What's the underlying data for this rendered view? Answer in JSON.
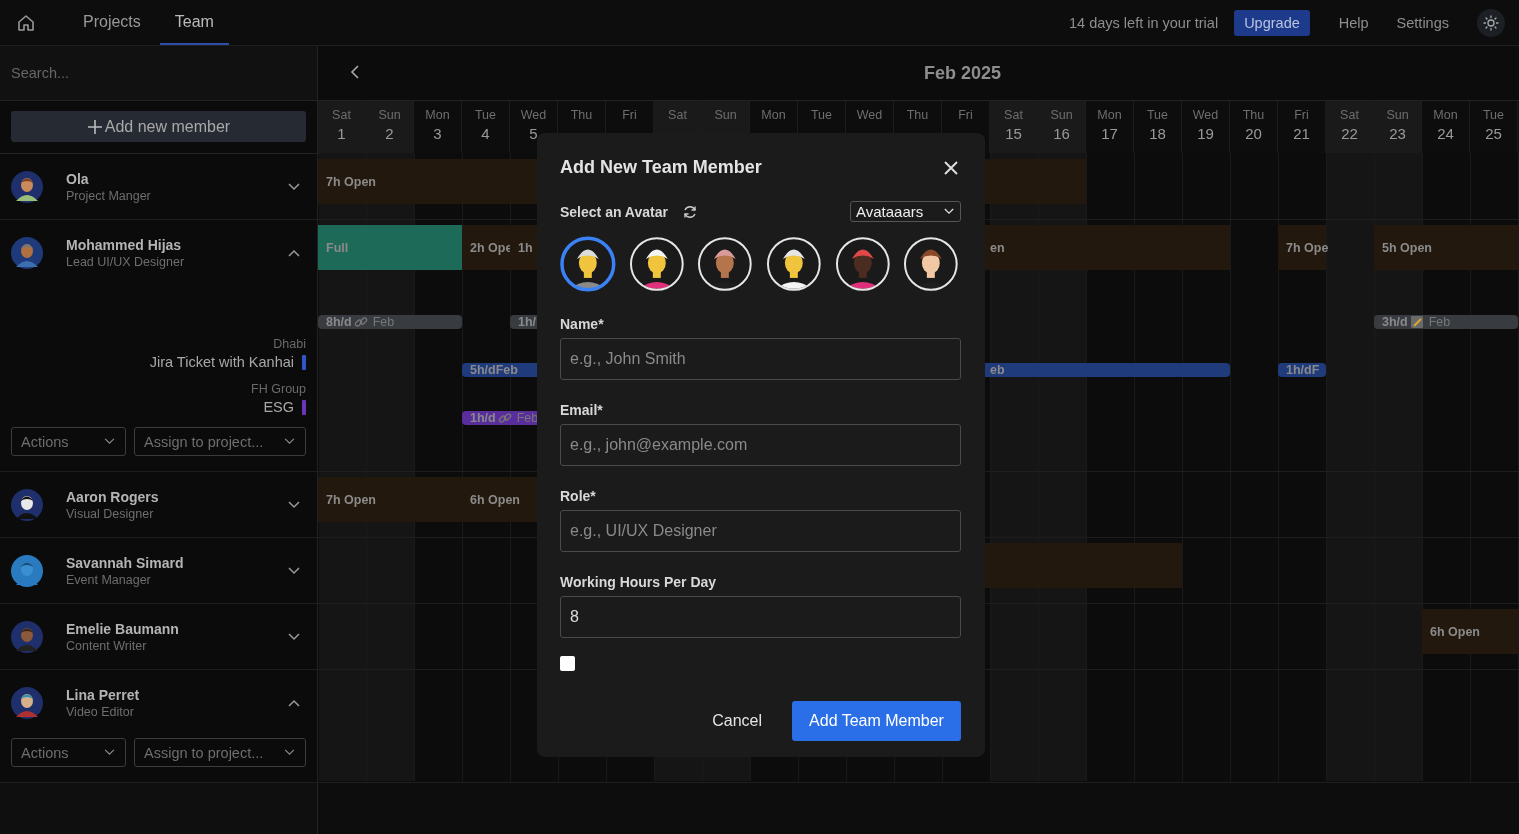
{
  "nav": {
    "tabs": [
      {
        "label": "Projects",
        "selected": false
      },
      {
        "label": "Team",
        "selected": true
      }
    ],
    "trial": "14 days left in your trial",
    "upgrade": "Upgrade",
    "links": [
      "Help",
      "Settings"
    ]
  },
  "sidebar": {
    "search_placeholder": "Search...",
    "add_button": "Add new member"
  },
  "calendar": {
    "month": "Feb 2025",
    "days": [
      {
        "name": "Sat",
        "number": "1",
        "weekend": true
      },
      {
        "name": "Sun",
        "number": "2",
        "weekend": true
      },
      {
        "name": "Mon",
        "number": "3",
        "weekend": false
      },
      {
        "name": "Tue",
        "number": "4",
        "weekend": false
      },
      {
        "name": "Wed",
        "number": "5",
        "weekend": false
      },
      {
        "name": "Thu",
        "weekend": false
      },
      {
        "name": "Fri",
        "weekend": false
      },
      {
        "name": "Sat",
        "weekend": true
      },
      {
        "name": "Sun",
        "weekend": true
      },
      {
        "name": "Mon",
        "weekend": false
      },
      {
        "name": "Tue",
        "weekend": false
      },
      {
        "name": "Wed",
        "weekend": false
      },
      {
        "name": "Thu",
        "weekend": false
      },
      {
        "name": "Fri",
        "weekend": false
      },
      {
        "name": "Sat",
        "number": "15",
        "weekend": true
      },
      {
        "name": "Sun",
        "number": "16",
        "weekend": true
      },
      {
        "name": "Mon",
        "number": "17",
        "weekend": false
      },
      {
        "name": "Tue",
        "number": "18",
        "weekend": false
      },
      {
        "name": "Wed",
        "number": "19",
        "weekend": false
      },
      {
        "name": "Thu",
        "number": "20",
        "weekend": false
      },
      {
        "name": "Fri",
        "number": "21",
        "weekend": false
      },
      {
        "name": "Sat",
        "number": "22",
        "weekend": true
      },
      {
        "name": "Sun",
        "number": "23",
        "weekend": true
      },
      {
        "name": "Mon",
        "number": "24",
        "weekend": false
      },
      {
        "name": "Tue",
        "number": "25",
        "weekend": false
      }
    ]
  },
  "members": [
    {
      "name": "Ola",
      "role": "Project Manger",
      "expanded": false,
      "lanes": [
        {
          "bars": [
            {
              "label": "7h Open",
              "color": "#23180e",
              "kind": "plain"
            }
          ]
        }
      ]
    },
    {
      "name": "Mohammed Hijas",
      "role": "Lead UI/UX Designer",
      "expanded": true,
      "projects": [
        {
          "client": "Dhabi",
          "name": "Jira Ticket with Kanhai",
          "color": "#2f55c8"
        },
        {
          "client": "FH Group",
          "name": "ESG",
          "color": "#6a35b8"
        }
      ],
      "actions": "Actions",
      "assign": "Assign to project...",
      "lanes": [
        {
          "bars": [
            {
              "label": "Full",
              "color": "#1d6a58",
              "kind": "plain"
            },
            {
              "label": "2h Ope",
              "color": "#23180e",
              "kind": "plain"
            },
            {
              "label": "1h",
              "color": "#23180e",
              "kind": "plain"
            },
            {
              "label": "en",
              "color": "#23180e",
              "kind": "continued"
            },
            {
              "label": "7h Ope",
              "color": "#23180e",
              "kind": "plain"
            },
            {
              "label": "5h Open",
              "color": "#23180e",
              "kind": "plain"
            }
          ]
        },
        {
          "bars": [
            {
              "label": "8h/d",
              "suffix": "Feb",
              "color": "#383b40",
              "kind": "linked"
            },
            {
              "label": "1h/",
              "color": "#383b40",
              "kind": "plain"
            },
            {
              "label": "3h/d",
              "suffix": "Feb",
              "color": "#383b40",
              "kind": "noted"
            }
          ]
        },
        {
          "bars": [
            {
              "label": "5h/dFeb",
              "color": "#1f3b7c",
              "kind": "plain"
            },
            {
              "label": "eb",
              "color": "#1f3b7c",
              "kind": "continued"
            },
            {
              "label": "1h/dF",
              "color": "#1f3b7c",
              "kind": "plain"
            }
          ]
        },
        {
          "bars": [
            {
              "label": "1h/d",
              "suffix": "Feb",
              "color": "#5a2d9c",
              "kind": "linked"
            }
          ]
        }
      ]
    },
    {
      "name": "Aaron Rogers",
      "role": "Visual Designer",
      "expanded": false,
      "lanes": [
        {
          "bars": [
            {
              "label": "7h Open",
              "color": "#23180e",
              "kind": "plain"
            },
            {
              "label": "6h Open",
              "color": "#23180e",
              "kind": "plain"
            }
          ]
        }
      ]
    },
    {
      "name": "Savannah Simard",
      "role": "Event Manager",
      "expanded": false,
      "lanes": [
        {
          "bars": [
            {
              "color": "#23180e",
              "kind": "plain"
            }
          ]
        }
      ]
    },
    {
      "name": "Emelie Baumann",
      "role": "Content Writer",
      "expanded": false,
      "lanes": [
        {
          "bars": [
            {
              "label": "6h Open",
              "color": "#23180e",
              "kind": "plain"
            }
          ]
        }
      ]
    },
    {
      "name": "Lina Perret",
      "role": "Video Editor",
      "expanded": true,
      "actions": "Actions",
      "assign": "Assign to project..."
    }
  ],
  "modal": {
    "title": "Add New Team Member",
    "avatar_label": "Select an Avatar",
    "avatar_style": "Avataaars",
    "avatars": [
      {
        "selected": true
      },
      {
        "selected": false
      },
      {
        "selected": false
      },
      {
        "selected": false
      },
      {
        "selected": false
      },
      {
        "selected": false
      }
    ],
    "fields": [
      {
        "label": "Name*",
        "placeholder": "e.g., John Smith"
      },
      {
        "label": "Email*",
        "placeholder": "e.g., john@example.com"
      },
      {
        "label": "Role*",
        "placeholder": "e.g., UI/UX Designer"
      },
      {
        "label": "Working Hours Per Day",
        "value": "8"
      }
    ],
    "checkbox": {
      "checked": false
    },
    "cancel": "Cancel",
    "submit": "Add Team Member"
  }
}
